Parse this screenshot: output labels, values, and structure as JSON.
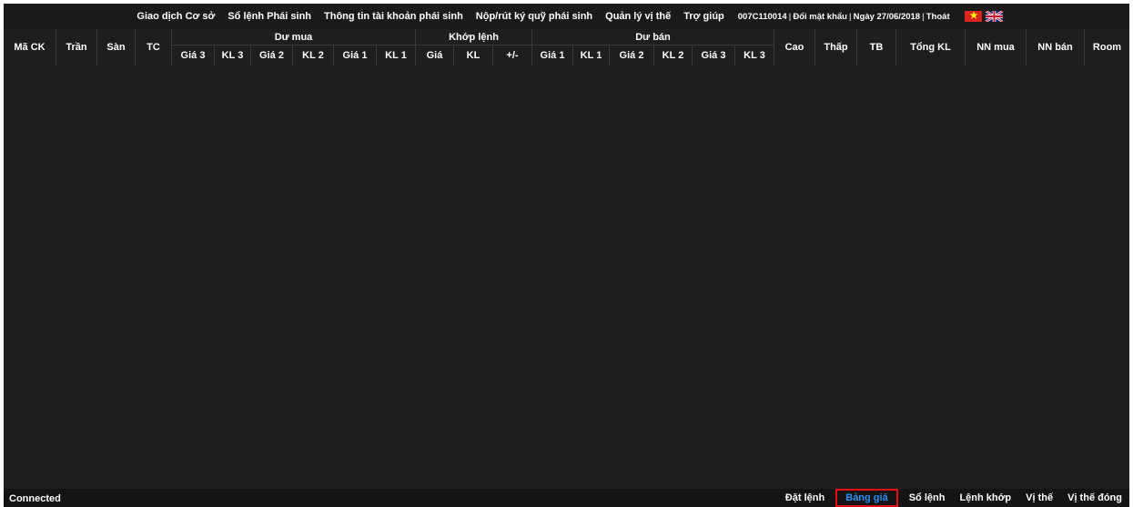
{
  "topnav": {
    "items": [
      "Giao dịch Cơ sở",
      "Sổ lệnh Phái sinh",
      "Thông tin tài khoản phái sinh",
      "Nộp/rút ký quỹ phái sinh",
      "Quản lý vị thế",
      "Trợ giúp"
    ],
    "account": "007C110014",
    "change_password": "Đổi mật khẩu",
    "date": "Ngày 27/06/2018",
    "logout": "Thoát",
    "separator": "|"
  },
  "table_header": {
    "ma_ck": "Mã CK",
    "tran": "Trần",
    "san": "Sàn",
    "tc": "TC",
    "du_mua": "Dư mua",
    "khop_lenh": "Khớp lệnh",
    "du_ban": "Dư bán",
    "cao": "Cao",
    "thap": "Thấp",
    "tb": "TB",
    "tong_kl": "Tổng KL",
    "nn_mua": "NN mua",
    "nn_ban": "NN bán",
    "room": "Room",
    "buy_sub": [
      "Giá 3",
      "KL 3",
      "Giá 2",
      "KL 2",
      "Giá 1",
      "KL 1"
    ],
    "match_sub": [
      "Giá",
      "KL",
      "+/-"
    ],
    "sell_sub": [
      "Giá 1",
      "KL 1",
      "Giá 2",
      "KL 2",
      "Giá 3",
      "KL 3"
    ]
  },
  "status_bar": {
    "connection": "Connected",
    "tabs": [
      "Đặt lệnh",
      "Bảng giá",
      "Sổ lệnh",
      "Lệnh khớp",
      "Vị thế",
      "Vị thế đóng"
    ],
    "active_tab": "Bảng giá"
  },
  "colors": {
    "background": "#1e1e1e",
    "active_tab_text": "#2d8ff0",
    "active_tab_border": "#e01010"
  }
}
